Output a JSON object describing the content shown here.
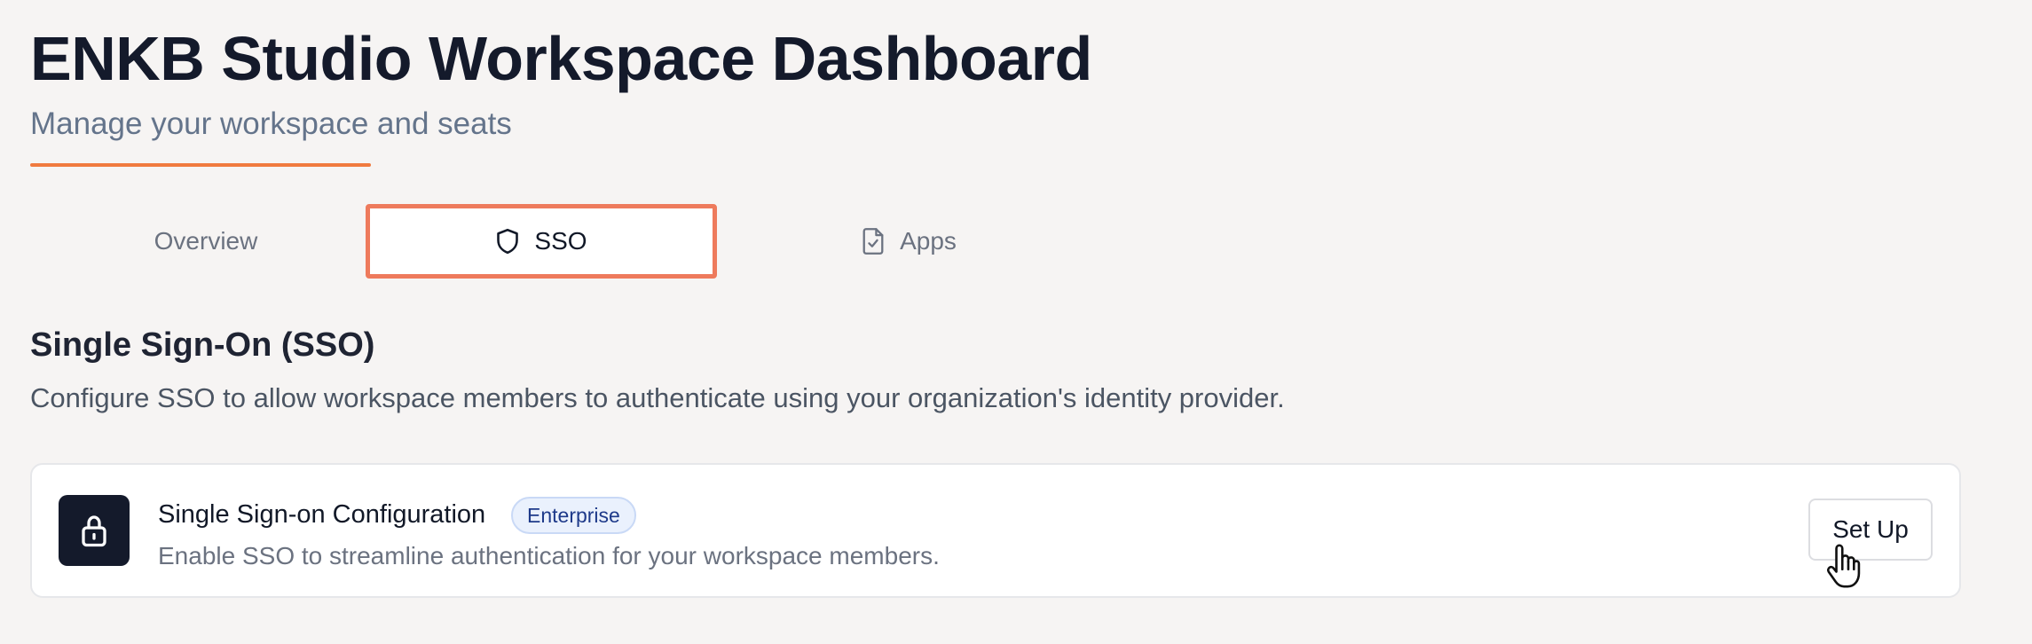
{
  "header": {
    "title": "ENKB Studio Workspace Dashboard",
    "subtitle": "Manage your workspace and seats",
    "accent_color": "#f07a3f"
  },
  "tabs": [
    {
      "label": "Overview",
      "icon": null,
      "selected": false
    },
    {
      "label": "SSO",
      "icon": "shield-icon",
      "selected": true
    },
    {
      "label": "Apps",
      "icon": "file-check-icon",
      "selected": false
    }
  ],
  "section": {
    "title": "Single Sign-On (SSO)",
    "description": "Configure SSO to allow workspace members to authenticate using your organization's identity provider."
  },
  "card": {
    "icon": "lock-icon",
    "title": "Single Sign-on Configuration",
    "badge": "Enterprise",
    "description": "Enable SSO to streamline authentication for your workspace members.",
    "button_label": "Set Up"
  },
  "colors": {
    "selected_tab_outline": "#ee7a5c",
    "badge_background": "#eaf1fd",
    "badge_text": "#1e3a8a",
    "icon_tile": "#141a2b"
  },
  "cursor": "hand-pointer-icon"
}
